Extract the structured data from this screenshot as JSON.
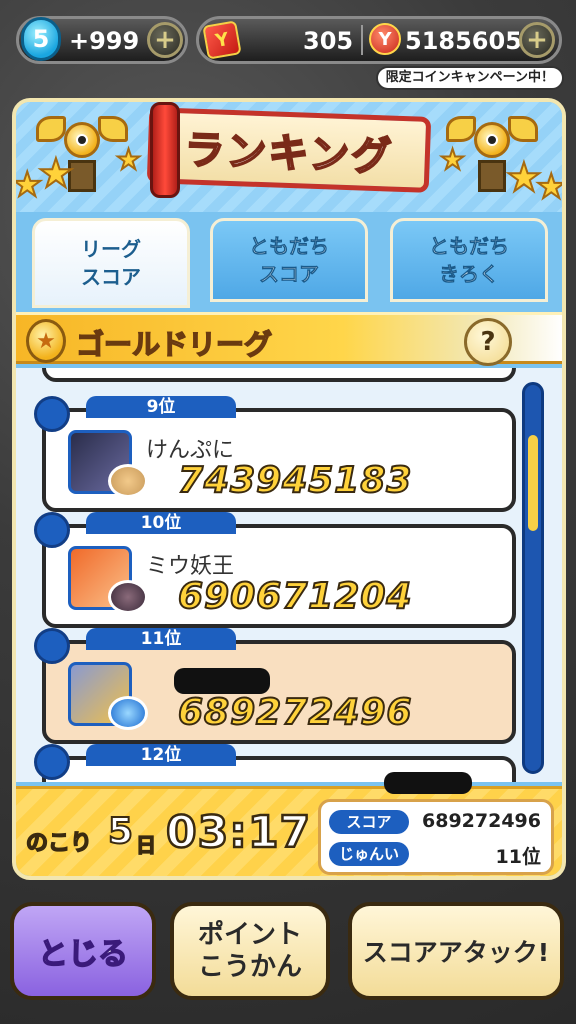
{
  "topbar": {
    "level": "5",
    "stamina": "+999",
    "plus": "+",
    "ticket_icon": "Y",
    "tickets": "305",
    "coin_icon": "Y",
    "coins": "5185605",
    "campaign": "限定コインキャンペーン中！"
  },
  "header": {
    "title": "ランキング"
  },
  "tabs": [
    {
      "label": "リーグ\nスコア",
      "active": true
    },
    {
      "label": "ともだち\nスコア",
      "active": false
    },
    {
      "label": "ともだち\nきろく",
      "active": false
    }
  ],
  "league": {
    "name": "ゴールドリーグ",
    "help": "?"
  },
  "ranking": [
    {
      "rank": "9位",
      "name": "けんぷに",
      "score": "743945183",
      "avatar_color": "#2a2d4a",
      "mini_color": "#f2c98a",
      "mine": false
    },
    {
      "rank": "10位",
      "name": "ミウ妖王",
      "score": "690671204",
      "avatar_color": "#f06a2a",
      "mini_color": "#6a4a5a",
      "mine": false
    },
    {
      "rank": "11位",
      "name": "",
      "score": "689272496",
      "avatar_color": "#8a9ad0",
      "mini_color": "#3a8ad8",
      "mine": true
    },
    {
      "rank": "12位",
      "name": "",
      "score": "",
      "mine": false
    }
  ],
  "timer": {
    "label": "のこり",
    "days": "5",
    "days_unit": "日",
    "time": "03:17"
  },
  "my_status": {
    "score_label": "スコア",
    "score": "689272496",
    "rank_label": "じゅんい",
    "rank": "11位"
  },
  "buttons": {
    "close": "とじる",
    "points": "ポイント\nこうかん",
    "attack": "スコアアタック!"
  },
  "colors": {
    "accent_blue": "#1d5fbf",
    "gold": "#ffd23a",
    "panel_sky": "#7ac3f0"
  }
}
